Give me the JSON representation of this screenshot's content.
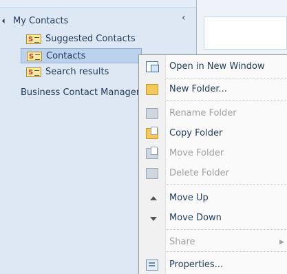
{
  "nav": {
    "group_label": "My Contacts",
    "items": [
      {
        "label": "Suggested Contacts"
      },
      {
        "label": "Contacts"
      },
      {
        "label": "Search results"
      }
    ],
    "bcm_label": "Business Contact Manager",
    "collapse_glyph": "‹"
  },
  "menu": {
    "open_new_window": "Open in New Window",
    "new_folder": "New Folder...",
    "rename_folder": "Rename Folder",
    "copy_folder": "Copy Folder",
    "move_folder": "Move Folder",
    "delete_folder": "Delete Folder",
    "move_up": "Move Up",
    "move_down": "Move Down",
    "share": "Share",
    "properties": "Properties...",
    "share_arrow": "▶"
  },
  "colors": {
    "nav_bg": "#dde8f4",
    "selected_bg": "#bcd1ec",
    "disabled_text": "#a0a0a0"
  }
}
